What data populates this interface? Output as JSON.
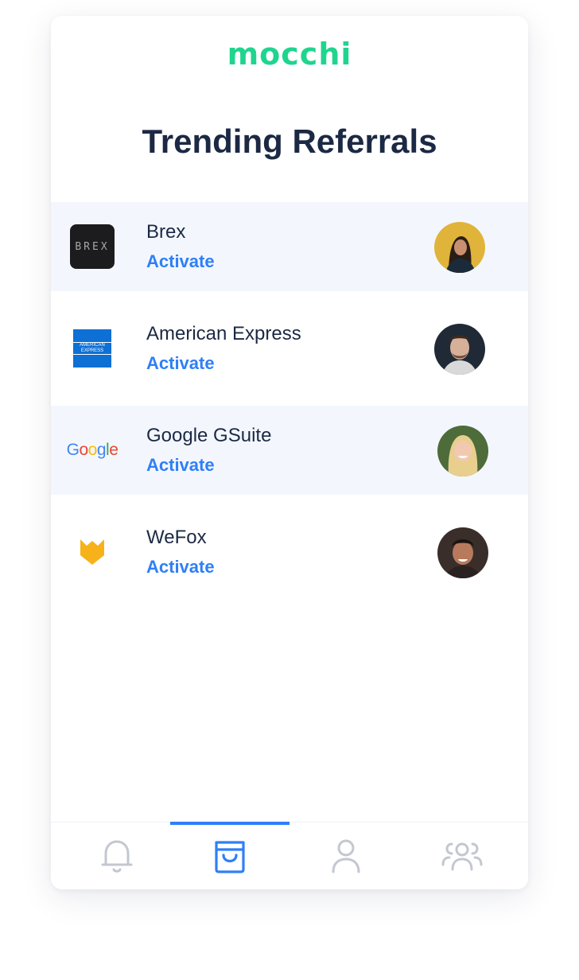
{
  "app": {
    "logo_text": "mocchi"
  },
  "page": {
    "title": "Trending Referrals"
  },
  "referrals": [
    {
      "name": "Brex",
      "action": "Activate",
      "brand_icon": "brex-logo",
      "logo_text": "BREX"
    },
    {
      "name": "American Express",
      "action": "Activate",
      "brand_icon": "amex-logo",
      "logo_text": "AMERICAN EXPRESS"
    },
    {
      "name": "Google GSuite",
      "action": "Activate",
      "brand_icon": "google-logo",
      "logo_text": "Google"
    },
    {
      "name": "WeFox",
      "action": "Activate",
      "brand_icon": "wefox-logo",
      "logo_text": ""
    }
  ],
  "tabbar": {
    "tabs": [
      {
        "icon": "bell-icon",
        "active": false
      },
      {
        "icon": "shopping-bag-icon",
        "active": true
      },
      {
        "icon": "user-icon",
        "active": false
      },
      {
        "icon": "group-icon",
        "active": false
      }
    ]
  },
  "colors": {
    "brand_green": "#1fd58e",
    "accent_blue": "#2f7ff7",
    "title_navy": "#1c2944",
    "row_highlight": "#f3f7fd",
    "inactive_icon": "#c3c7d0"
  }
}
